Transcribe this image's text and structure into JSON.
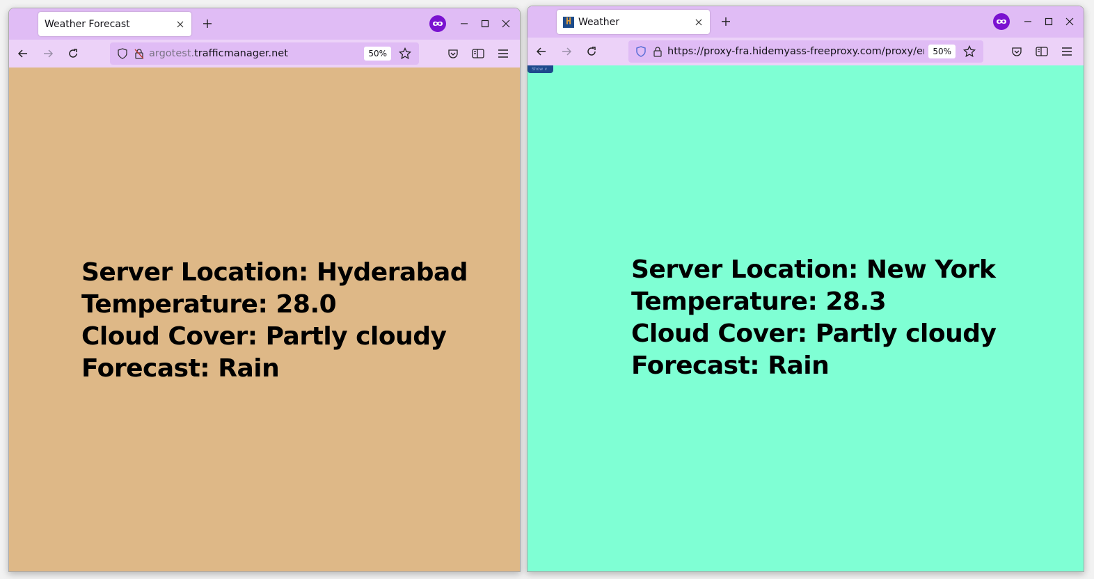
{
  "windows": [
    {
      "tab": {
        "title": "Weather Forecast",
        "favicon": null
      },
      "address": {
        "url_dim": "argotest.",
        "url_main": "trafficmanager.net",
        "zoom": "50%",
        "security_icon": "lock-strike-icon"
      },
      "page": {
        "background": "#deb887",
        "lines": [
          "Server Location: Hyderabad",
          "Temperature: 28.0",
          "Cloud Cover: Partly cloudy",
          "Forecast: Rain"
        ]
      }
    },
    {
      "tab": {
        "title": "Weather",
        "favicon": "H"
      },
      "address": {
        "url_dim": "",
        "url_main": "https://proxy-fra.hidemyass-freeproxy.com/proxy/en",
        "zoom": "50%",
        "security_icon": "lock-icon"
      },
      "page": {
        "background": "#7fffd4",
        "show_button": "Show ∨",
        "lines": [
          "Server Location: New York",
          "Temperature: 28.3",
          "Cloud Cover: Partly cloudy",
          "Forecast: Rain"
        ]
      }
    }
  ],
  "colors": {
    "titlebar": "#e0bcf5",
    "navbar": "#ecd2f8",
    "private_mask": "#7a12d0"
  }
}
